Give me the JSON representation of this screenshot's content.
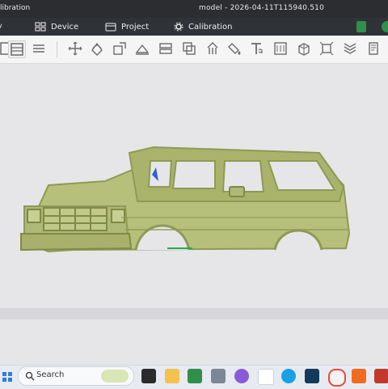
{
  "window": {
    "title_left": "libration",
    "title_center": "model - 2026-04-11T115940.510"
  },
  "menu": {
    "items": [
      {
        "label": "Device"
      },
      {
        "label": "Project"
      },
      {
        "label": "Calibration"
      }
    ]
  },
  "toolbar": {
    "icons": [
      "select-icon",
      "selection-window-icon",
      "list-icon",
      "move-icon",
      "rotate-icon",
      "scale-icon",
      "place-on-face-icon",
      "split-icon",
      "boolean-icon",
      "support-icon",
      "paint-icon",
      "text-icon",
      "bed-icon",
      "cube-icon",
      "measure-icon",
      "layers-icon",
      "page-icon"
    ]
  },
  "taskbar": {
    "search_label": "Search",
    "apps": [
      "windows-icon",
      "search-icon",
      "widgets-icon",
      "terminal-icon",
      "folder-icon",
      "sheets-icon",
      "calculator-icon",
      "gem-icon",
      "file-icon",
      "edge-icon",
      "app-icon",
      "chrome-icon",
      "settings-icon",
      "pdf-icon"
    ]
  },
  "colors": {
    "titlebar": "#2b2d31",
    "menubar": "#2f3237",
    "accent": "#2f8f4b",
    "truck": "#b6c07a"
  }
}
